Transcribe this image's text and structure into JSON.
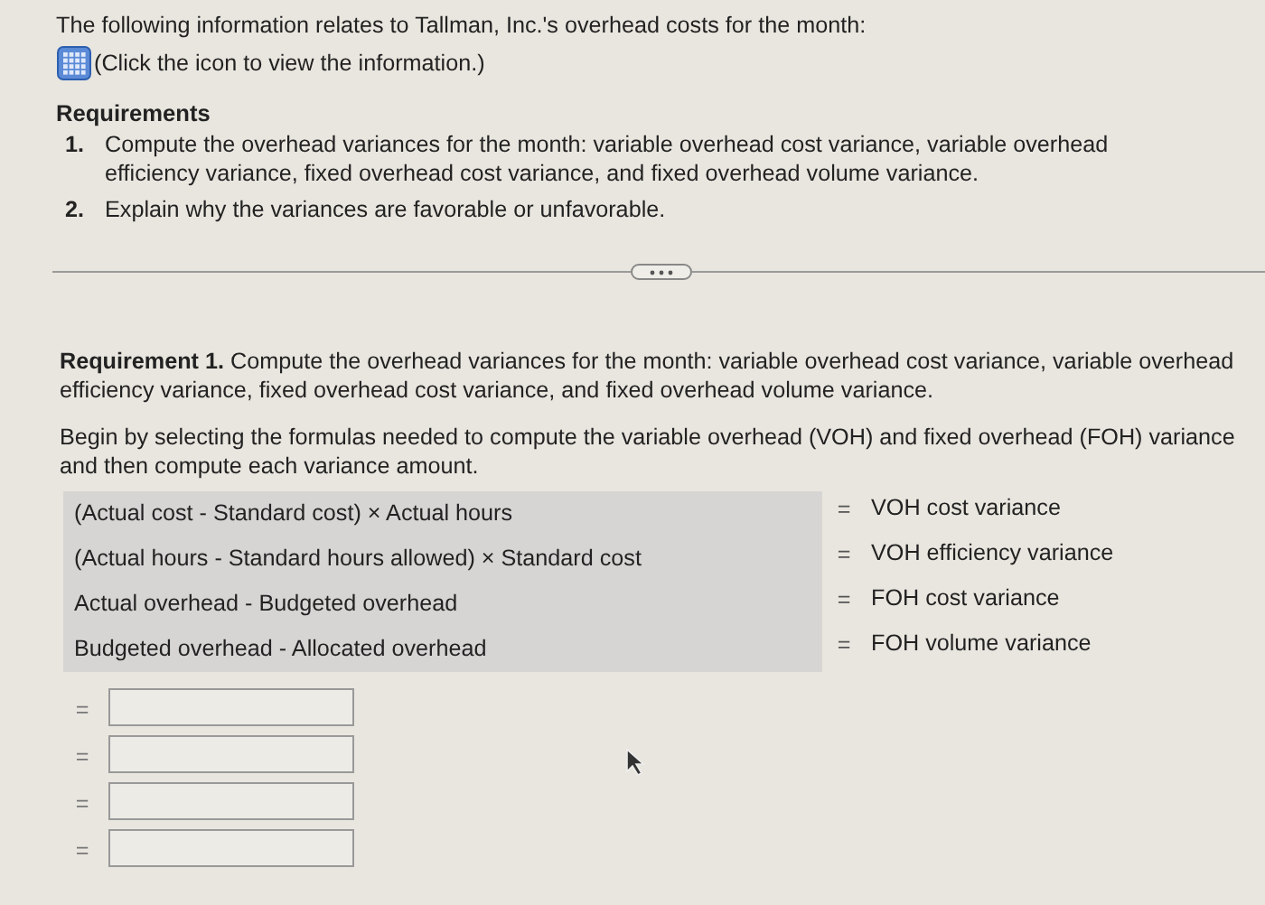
{
  "intro": "The following information relates to Tallman, Inc.'s overhead costs for the month:",
  "info_link": "(Click the icon to view the information.)",
  "requirements": {
    "heading": "Requirements",
    "items": [
      {
        "number": "1.",
        "text": "Compute the overhead variances for the month: variable overhead cost variance, variable overhead efficiency variance, fixed overhead cost variance, and fixed overhead volume variance."
      },
      {
        "number": "2.",
        "text": "Explain why the variances are favorable or unfavorable."
      }
    ]
  },
  "requirement_1": "**Requirement 1.** Compute the overhead variances for the month: variable overhead cost variance, variable overhead efficiency variance, fixed overhead cost variance, and fixed overhead volume variance.",
  "instructions": "Begin by selecting the formulas needed to compute the variable overhead (VOH) and fixed overhead (FOH) variance and then compute each variance amount.",
  "formulas": [
    {
      "formula": "(Actual cost - Standard cost) × Actual hours",
      "equals": "=",
      "result": "VOH cost variance"
    },
    {
      "formula": "(Actual hours - Standard hours allowed) × Standard cost",
      "equals": "=",
      "result": "VOH efficiency variance"
    },
    {
      "formula": "Actual overhead - Budgeted overhead",
      "equals": "=",
      "result": "FOH cost variance"
    },
    {
      "formula": "Budgeted overhead - Allocated overhead",
      "equals": "=",
      "result": "FOH volume variance"
    }
  ],
  "answers": [
    {
      "equals": "="
    },
    {
      "equals": "="
    },
    {
      "equals": "="
    },
    {
      "equals": "="
    }
  ]
}
